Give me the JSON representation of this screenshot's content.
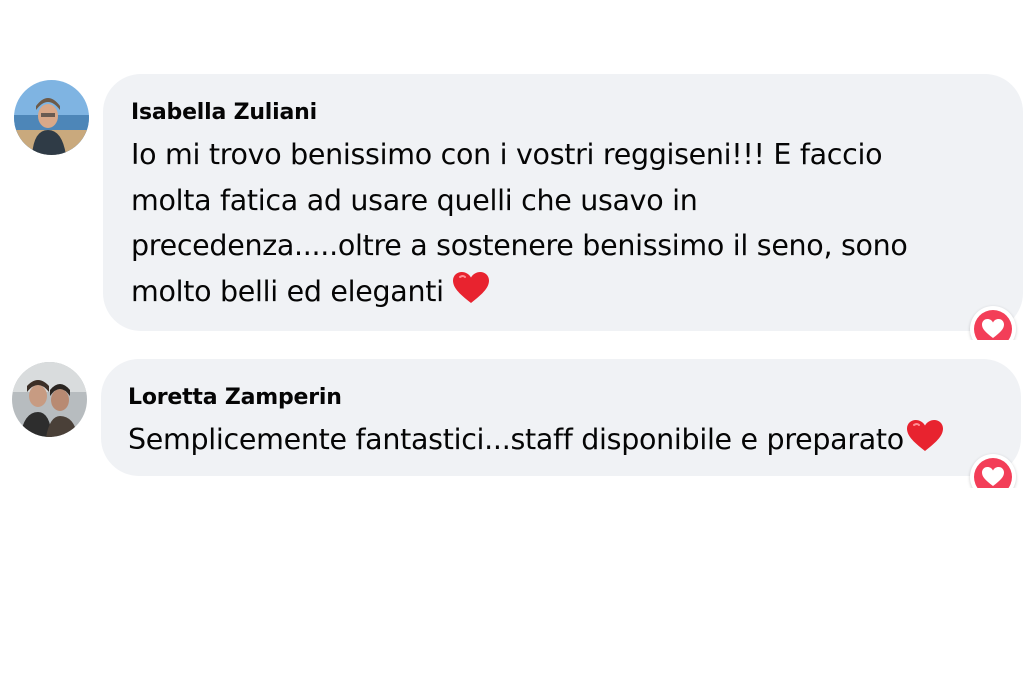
{
  "comments": [
    {
      "author": "Isabella Zuliani",
      "lines": [
        "Io mi trovo benissimo con i vostri reggiseni!!! E faccio",
        "molta fatica ad usare quelli che usavo in",
        "precedenza.....oltre a sostenere benissimo il seno, sono",
        "molto belli ed eleganti"
      ],
      "trailing_emoji": "heart-emoji",
      "reaction": "love-reaction"
    },
    {
      "author": "Loretta Zamperin",
      "lines": [
        "Semplicemente fantastici...staff disponibile e preparato"
      ],
      "trailing_emoji": "heart-emoji",
      "reaction": "love-reaction"
    }
  ],
  "colors": {
    "bubble": "#f0f2f5",
    "text": "#050505",
    "love_reaction": "#f33e58",
    "heart_emoji": "#e8232f"
  }
}
